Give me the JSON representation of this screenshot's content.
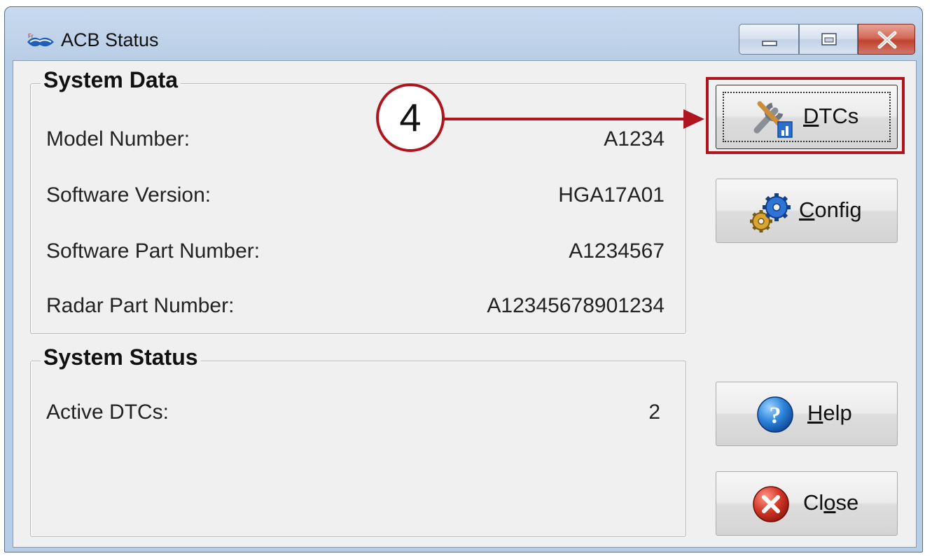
{
  "window": {
    "title": "ACB Status",
    "icon": "app-logo-icon"
  },
  "system_data": {
    "title": "System Data",
    "rows": [
      {
        "label": "Model Number:",
        "value": "A1234"
      },
      {
        "label": "Software Version:",
        "value": "HGA17A01"
      },
      {
        "label": "Software Part Number:",
        "value": "A1234567"
      },
      {
        "label": "Radar Part Number:",
        "value": "A12345678901234"
      }
    ]
  },
  "system_status": {
    "title": "System Status",
    "rows": [
      {
        "label": "Active DTCs:",
        "value": "2"
      }
    ]
  },
  "buttons": {
    "dtcs": {
      "first": "D",
      "rest": "TCs",
      "icon": "tools-icon"
    },
    "config": {
      "first": "C",
      "rest": "onfig",
      "icon": "gears-icon"
    },
    "help": {
      "first": "H",
      "rest": "elp",
      "icon": "help-icon"
    },
    "close": {
      "first": "Cl",
      "underline": "o",
      "rest": "se",
      "icon": "close-circle-icon"
    }
  },
  "callout": {
    "number": "4",
    "color": "#b0141e"
  }
}
